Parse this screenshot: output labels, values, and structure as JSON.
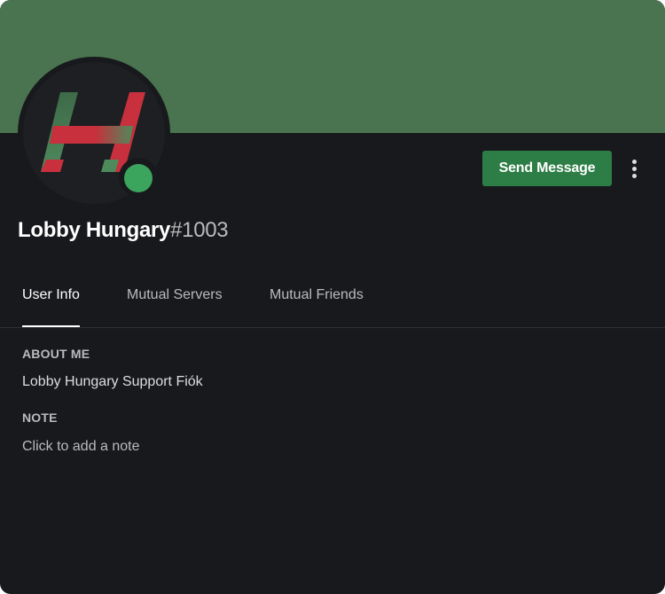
{
  "profile": {
    "username": "Lobby Hungary",
    "discriminator": "#1003",
    "status": "online",
    "status_color": "#3ba55d",
    "banner_color": "#4a7350",
    "avatar_logo": "lobby-hungary-logo"
  },
  "actions": {
    "send_message_label": "Send Message",
    "more_icon": "vertical-ellipsis-icon",
    "accent_color": "#2d7d46"
  },
  "tabs": [
    {
      "label": "User Info",
      "active": true
    },
    {
      "label": "Mutual Servers",
      "active": false
    },
    {
      "label": "Mutual Friends",
      "active": false
    }
  ],
  "about": {
    "title": "ABOUT ME",
    "text": "Lobby Hungary Support Fiók"
  },
  "note": {
    "title": "NOTE",
    "placeholder": "Click to add a note",
    "value": ""
  }
}
